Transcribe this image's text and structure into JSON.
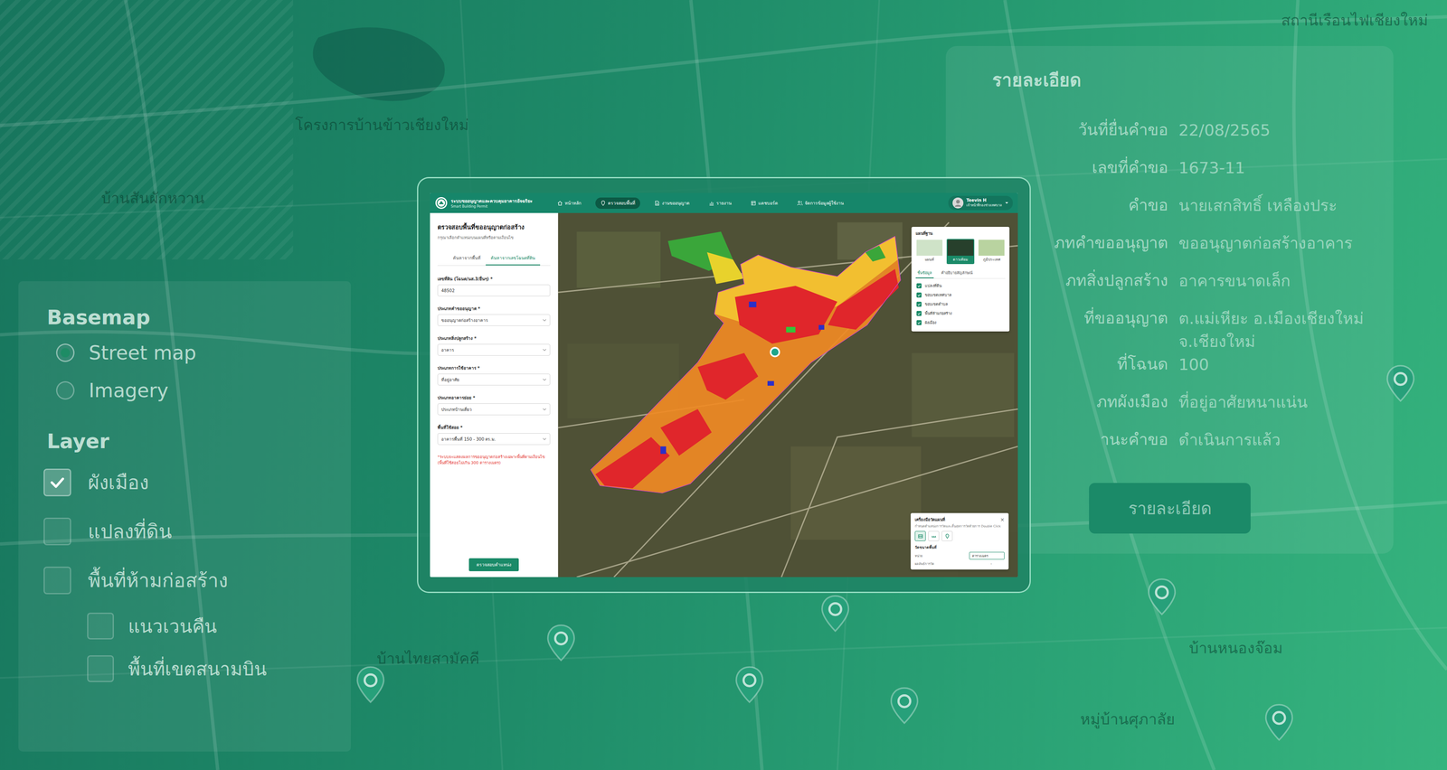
{
  "background": {
    "map_labels": [
      "โครงการบ้านข้าวเชียงใหม่",
      "บ้านสันผักหวาน",
      "บ้านไทยสามัคคี",
      "บ้านหนองจ๊อม",
      "หมู่บ้านศุภาลัย",
      "สถานีเรือนไฟเชียงใหม่"
    ]
  },
  "basemap_panel": {
    "title": "Basemap",
    "options": [
      {
        "label": "Street map",
        "selected": true
      },
      {
        "label": "Imagery",
        "selected": false
      }
    ]
  },
  "layer_panel": {
    "title": "Layer",
    "items": [
      {
        "label": "ผังเมือง",
        "checked": true,
        "nested": false
      },
      {
        "label": "แปลงที่ดิน",
        "checked": false,
        "nested": false
      },
      {
        "label": "พื้นที่ห้ามก่อสร้าง",
        "checked": false,
        "nested": false
      },
      {
        "label": "แนวเวนคืน",
        "checked": false,
        "nested": true
      },
      {
        "label": "พื้นที่เขตสนามบิน",
        "checked": false,
        "nested": true
      }
    ]
  },
  "detail_panel": {
    "title": "รายละเอียด",
    "rows": [
      {
        "label": "วันที่ยื่นคำขอ",
        "value": "22/08/2565"
      },
      {
        "label": "เลขที่คำขอ",
        "value": "1673-11"
      },
      {
        "label": "คำขอ",
        "value": "นายเสกสิทธิ์ เหลืองประ"
      },
      {
        "label": "ภทคำขออนุญาต",
        "value": "ขออนุญาตก่อสร้างอาคาร"
      },
      {
        "label": "ภทสิ่งปลูกสร้าง",
        "value": "อาคารขนาดเล็ก"
      },
      {
        "label": "ที่ขออนุญาต",
        "value": "ต.แม่เหียะ อ.เมืองเชียงใหม่ จ.เชียงใหม่"
      },
      {
        "label": "ที่โฉนด",
        "value": "100"
      },
      {
        "label": "ภทผังเมือง",
        "value": "ที่อยู่อาศัยหนาแน่น"
      },
      {
        "label": "านะคำขอ",
        "value": "ดำเนินการแล้ว"
      }
    ],
    "button": "รายละเอียด"
  },
  "app": {
    "brand": {
      "name": "ระบบขออนุญาตและควบคุมอาคารอัจฉริยะ",
      "subtitle": "Smart Building Permit"
    },
    "nav": [
      {
        "label": "หน้าหลัก",
        "selected": false
      },
      {
        "label": "ตรวจสอบพื้นที่",
        "selected": true
      },
      {
        "label": "งานขออนุญาต",
        "selected": false
      },
      {
        "label": "รายงาน",
        "selected": false
      },
      {
        "label": "แดชบอร์ด",
        "selected": false
      },
      {
        "label": "จัดการข้อมูลผู้ใช้งาน",
        "selected": false
      }
    ],
    "user": {
      "name": "Teevin H",
      "role": "เจ้าหน้าที่กองช่างเทศบาล"
    },
    "sidebar": {
      "title": "ตรวจสอบพื้นที่ขออนุญาตก่อสร้าง",
      "subtitle": "กรุณาเลือกตำแหน่งบนแผนที่หรือตามเงื่อนไข",
      "tabs": [
        {
          "label": "ค้นหาจากพื้นที่",
          "selected": false
        },
        {
          "label": "ค้นหาจากเลขโฉนดที่ดิน",
          "selected": true
        }
      ],
      "fields": [
        {
          "label": "เลขที่ดิน (โฉนด/นส.3/อื่นๆ) *",
          "value": "48502",
          "kind": "input"
        },
        {
          "label": "ประเภทคำขออนุญาต *",
          "value": "ขออนุญาตก่อสร้างอาคาร",
          "kind": "select"
        },
        {
          "label": "ประเภทสิ่งปลูกสร้าง *",
          "value": "อาคาร",
          "kind": "select"
        },
        {
          "label": "ประเภทการใช้อาคาร *",
          "value": "ที่อยู่อาศัย",
          "kind": "select"
        },
        {
          "label": "ประเภทอาคารย่อย *",
          "value": "ประเภทบ้านเดี่ยว",
          "kind": "select"
        },
        {
          "label": "พื้นที่ใช้สอย *",
          "value": "อาคารพื้นที่ 150 - 300 ตร.ม.",
          "kind": "select"
        }
      ],
      "note": "*ระบบจะแสดงผลการขออนุญาตก่อสร้างเฉพาะพื้นที่ตามเงื่อนไข (พื้นที่ใช้สอยไม่เกิน 300 ตารางเมตร)",
      "button": "ตรวจสอบตำแหน่ง"
    },
    "layers_box": {
      "title": "แผนที่ฐาน",
      "basemaps": [
        {
          "label": "แผนที่",
          "selected": false
        },
        {
          "label": "ดาวเทียม",
          "selected": true
        },
        {
          "label": "ภูมิประเทศ",
          "selected": false
        }
      ],
      "tabs": [
        {
          "label": "ชั้นข้อมูล",
          "selected": true
        },
        {
          "label": "คำอธิบายสัญลักษณ์",
          "selected": false
        }
      ],
      "layers": [
        {
          "label": "แปลงที่ดิน",
          "checked": true
        },
        {
          "label": "ขอบเขตเทศบาล",
          "checked": true
        },
        {
          "label": "ขอบเขตตำบล",
          "checked": true
        },
        {
          "label": "พื้นที่ห้ามก่อสร้าง",
          "checked": true
        },
        {
          "label": "ผังเมือง",
          "checked": true
        }
      ]
    },
    "measure": {
      "title": "เครื่องมือวัดแผนที่",
      "close": "×",
      "hint": "กำหนดตำแหน่งการวัดและสิ้นสุดการวัดด้วยการ Double Click",
      "tools": [
        {
          "selected": true
        },
        {
          "selected": false
        },
        {
          "selected": false
        }
      ],
      "section": "วัดขนาดพื้นที่",
      "unit_label": "หน่วย",
      "unit_value": "ตารางเมตร",
      "result_label": "ผลลัพธ์การวัด",
      "result_value": "-"
    }
  }
}
